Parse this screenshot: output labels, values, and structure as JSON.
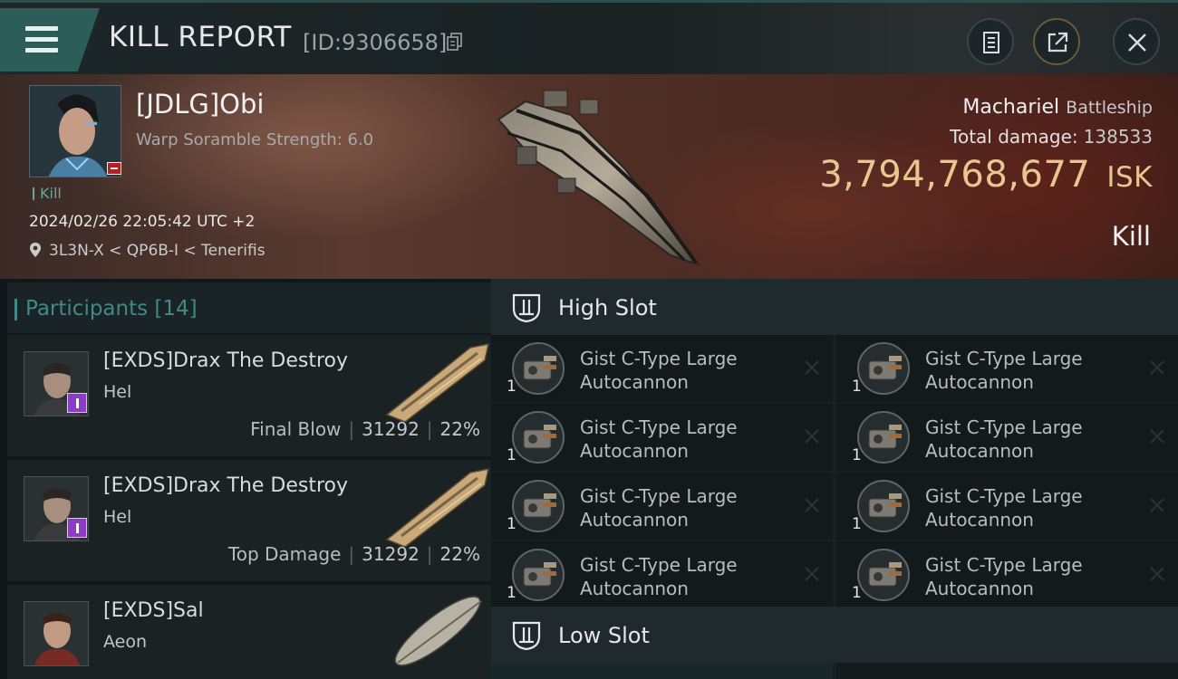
{
  "header": {
    "title": "KILL REPORT",
    "report_id": "[ID:9306658]",
    "icons": [
      "menu-icon",
      "copy-icon",
      "document-icon",
      "share-icon",
      "close-icon"
    ]
  },
  "victim": {
    "pilot_name": "[JDLG]Obi",
    "scramble": "Warp Soramble Strength: 6.0",
    "result_tag": "Kill",
    "datetime": "2024/02/26 22:05:42 UTC +2",
    "location": "3L3N-X < QP6B-I < Tenerifis",
    "ship_name": "Machariel",
    "ship_class": "Battleship",
    "total_damage_label": "Total damage:",
    "total_damage_value": "138533",
    "isk_value": "3,794,768,677",
    "isk_unit": "ISK",
    "outcome": "Kill"
  },
  "participants": {
    "label": "Participants",
    "count": "[14]",
    "rows": [
      {
        "name": "[EXDS]Drax The Destroy",
        "ship": "Hel",
        "role": "Final Blow",
        "damage": "31292",
        "percent": "22%"
      },
      {
        "name": "[EXDS]Drax The Destroy",
        "ship": "Hel",
        "role": "Top Damage",
        "damage": "31292",
        "percent": "22%"
      },
      {
        "name": "[EXDS]Sal",
        "ship": "Aeon"
      }
    ]
  },
  "fitting": {
    "high_slot_title": "High Slot",
    "low_slot_title": "Low Slot",
    "high_slot_modules": [
      {
        "line1": "Gist C-Type Large",
        "line2": "Autocannon",
        "qty": "1"
      },
      {
        "line1": "Gist C-Type Large",
        "line2": "Autocannon",
        "qty": "1"
      },
      {
        "line1": "Gist C-Type Large",
        "line2": "Autocannon",
        "qty": "1"
      },
      {
        "line1": "Gist C-Type Large",
        "line2": "Autocannon",
        "qty": "1"
      },
      {
        "line1": "Gist C-Type Large",
        "line2": "Autocannon",
        "qty": "1"
      },
      {
        "line1": "Gist C-Type Large",
        "line2": "Autocannon",
        "qty": "1"
      },
      {
        "line1": "Gist C-Type Large",
        "line2": "Autocannon",
        "qty": "1"
      },
      {
        "line1": "Gist C-Type Large",
        "line2": "Autocannon",
        "qty": "1"
      }
    ]
  },
  "colors": {
    "accent_teal": "#2c5d58",
    "isk_gold": "#e8c690",
    "corp_badge_purple": "#8c3cc8",
    "loss_badge_red": "#b81f1f"
  }
}
